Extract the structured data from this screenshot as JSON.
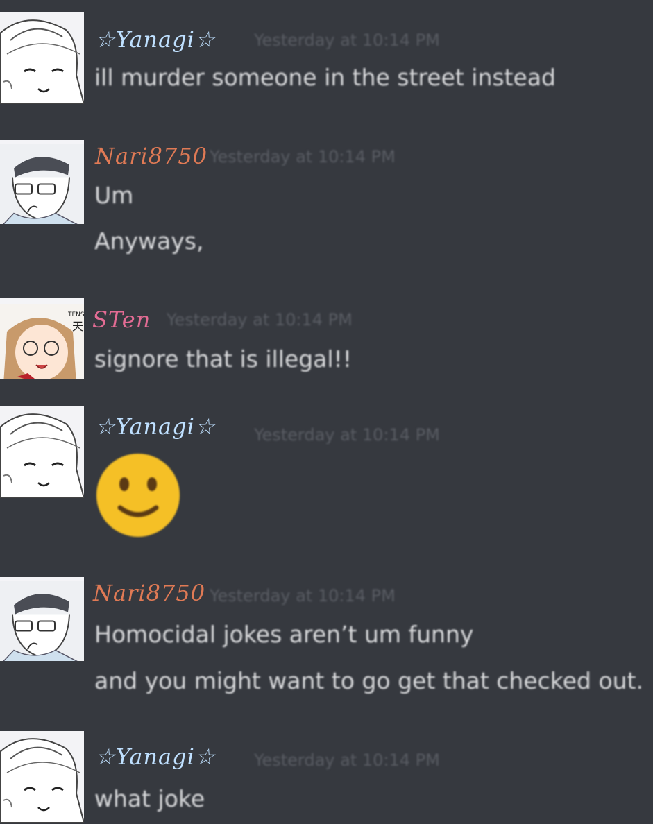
{
  "messages": [
    {
      "author": "☆Yanagi☆",
      "author_color": "#bfe0ff",
      "avatar": "yanagi-avatar",
      "timestamp": "Yesterday at 10:14 PM",
      "lines": [
        "ill murder someone in the street instead"
      ]
    },
    {
      "author": "Nari8750",
      "author_color": "#e07a55",
      "avatar": "nari-avatar",
      "timestamp": "Yesterday at 10:14 PM",
      "lines": [
        "Um",
        "Anyways,"
      ]
    },
    {
      "author": "STen",
      "author_color": "#e36c94",
      "avatar": "sten-avatar",
      "timestamp": "Yesterday at 10:14 PM",
      "lines": [
        "signore that is illegal!!"
      ]
    },
    {
      "author": "☆Yanagi☆",
      "author_color": "#bfe0ff",
      "avatar": "yanagi-avatar",
      "timestamp": "Yesterday at 10:14 PM",
      "emoji": "slightly-smiling-face"
    },
    {
      "author": "Nari8750",
      "author_color": "#e07a55",
      "avatar": "nari-avatar",
      "timestamp": "Yesterday at 10:14 PM",
      "lines": [
        "Homocidal jokes aren’t um funny",
        "and you might want to go get that checked out."
      ]
    },
    {
      "author": "☆Yanagi☆",
      "author_color": "#bfe0ff",
      "avatar": "yanagi-avatar",
      "timestamp": "Yesterday at 10:14 PM",
      "lines": [
        "what joke"
      ]
    }
  ]
}
